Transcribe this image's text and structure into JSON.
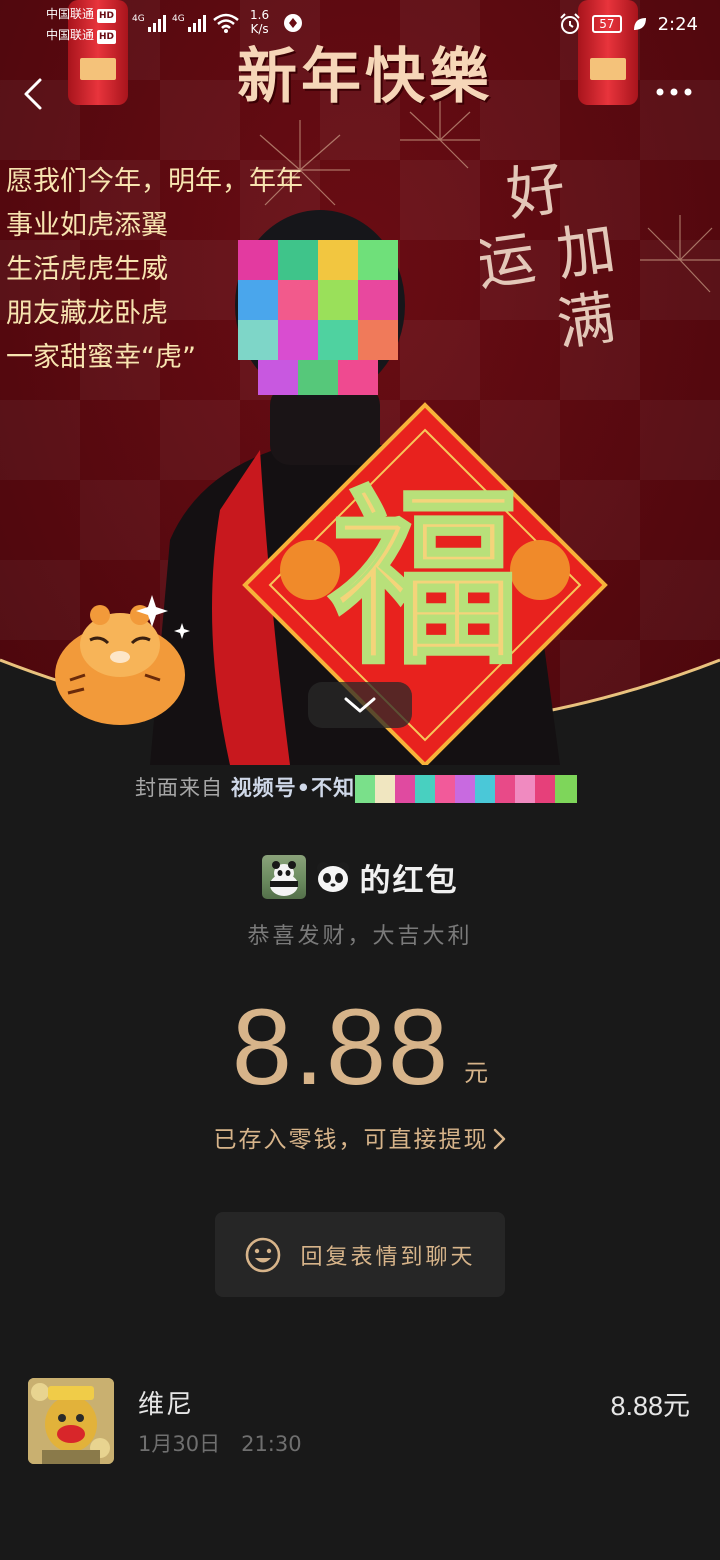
{
  "status_bar": {
    "carrier_1": "中国联通",
    "carrier_2": "中国联通",
    "hd": "HD",
    "network_1": "4G",
    "network_2": "4G",
    "net_speed_value": "1.6",
    "net_speed_unit": "K/s",
    "battery": "57",
    "time": "2:24"
  },
  "cover": {
    "title": "新年快樂",
    "blessing_lines": [
      "愿我们今年，明年，年年",
      "事业如虎添翼",
      "生活虎虎生威",
      "朋友藏龙卧虎",
      "一家甜蜜幸“虎”"
    ],
    "handwriting": "好运加满",
    "poster_character": "福",
    "source_prefix": "封面来自",
    "source_name": "视频号•不知"
  },
  "packet": {
    "sender_title": "的红包",
    "greeting": "恭喜发财，大吉大利",
    "amount": "8.88",
    "unit": "元",
    "deposit_note": "已存入零钱，可直接提现",
    "reply_label": "回复表情到聊天"
  },
  "record": {
    "name": "维尼",
    "time": "1月30日　21:30",
    "amount": "8.88元"
  },
  "colors": {
    "background": "#191919",
    "gold_text": "#d7b48a",
    "cover_red": "#5e0a10"
  },
  "icons": [
    "back-icon",
    "more-icon",
    "chevron-down-icon",
    "smile-icon",
    "chevron-right-icon",
    "panda-icon"
  ]
}
